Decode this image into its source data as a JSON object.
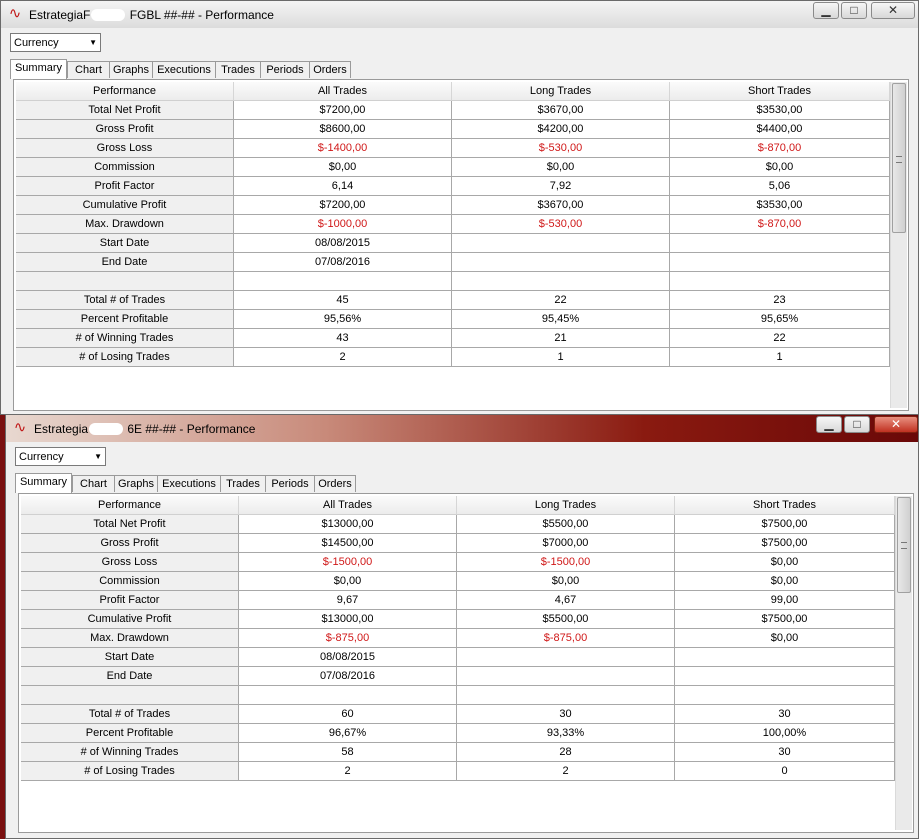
{
  "windows": [
    {
      "title_prefix": "EstrategiaF",
      "title_suffix": " FGBL ##-## - Performance",
      "dropdown_value": "Currency",
      "tabs": [
        "Summary",
        "Chart",
        "Graphs",
        "Executions",
        "Trades",
        "Periods",
        "Orders"
      ],
      "active_tab": "Summary",
      "columns": [
        "Performance",
        "All Trades",
        "Long Trades",
        "Short Trades"
      ],
      "rows": [
        [
          "Total Net Profit",
          "$7200,00",
          "$3670,00",
          "$3530,00"
        ],
        [
          "Gross Profit",
          "$8600,00",
          "$4200,00",
          "$4400,00"
        ],
        [
          "Gross Loss",
          "$-1400,00",
          "$-530,00",
          "$-870,00"
        ],
        [
          "Commission",
          "$0,00",
          "$0,00",
          "$0,00"
        ],
        [
          "Profit Factor",
          "6,14",
          "7,92",
          "5,06"
        ],
        [
          "Cumulative Profit",
          "$7200,00",
          "$3670,00",
          "$3530,00"
        ],
        [
          "Max. Drawdown",
          "$-1000,00",
          "$-530,00",
          "$-870,00"
        ],
        [
          "Start Date",
          "08/08/2015",
          "",
          ""
        ],
        [
          "End Date",
          "07/08/2016",
          "",
          ""
        ],
        [
          "",
          "",
          "",
          ""
        ],
        [
          "Total # of Trades",
          "45",
          "22",
          "23"
        ],
        [
          "Percent Profitable",
          "95,56%",
          "95,45%",
          "95,65%"
        ],
        [
          "# of Winning Trades",
          "43",
          "21",
          "22"
        ],
        [
          "# of Losing Trades",
          "2",
          "1",
          "1"
        ]
      ]
    },
    {
      "title_prefix": "Estrategia",
      "title_suffix": " 6E ##-## - Performance",
      "dropdown_value": "Currency",
      "tabs": [
        "Summary",
        "Chart",
        "Graphs",
        "Executions",
        "Trades",
        "Periods",
        "Orders"
      ],
      "active_tab": "Summary",
      "columns": [
        "Performance",
        "All Trades",
        "Long Trades",
        "Short Trades"
      ],
      "rows": [
        [
          "Total Net Profit",
          "$13000,00",
          "$5500,00",
          "$7500,00"
        ],
        [
          "Gross Profit",
          "$14500,00",
          "$7000,00",
          "$7500,00"
        ],
        [
          "Gross Loss",
          "$-1500,00",
          "$-1500,00",
          "$0,00"
        ],
        [
          "Commission",
          "$0,00",
          "$0,00",
          "$0,00"
        ],
        [
          "Profit Factor",
          "9,67",
          "4,67",
          "99,00"
        ],
        [
          "Cumulative Profit",
          "$13000,00",
          "$5500,00",
          "$7500,00"
        ],
        [
          "Max. Drawdown",
          "$-875,00",
          "$-875,00",
          "$0,00"
        ],
        [
          "Start Date",
          "08/08/2015",
          "",
          ""
        ],
        [
          "End Date",
          "07/08/2016",
          "",
          ""
        ],
        [
          "",
          "",
          "",
          ""
        ],
        [
          "Total # of Trades",
          "60",
          "30",
          "30"
        ],
        [
          "Percent Profitable",
          "96,67%",
          "93,33%",
          "100,00%"
        ],
        [
          "# of Winning Trades",
          "58",
          "28",
          "30"
        ],
        [
          "# of Losing Trades",
          "2",
          "2",
          "0"
        ]
      ]
    }
  ],
  "colors": {
    "negative": "#d01818",
    "accent": "#c01818"
  },
  "icons": {
    "app": "app-logo-icon",
    "minimize": "minimize-icon",
    "maximize": "maximize-icon",
    "close": "close-icon",
    "dropdown": "chevron-down-icon",
    "scroll_grip": "grip-icon"
  }
}
